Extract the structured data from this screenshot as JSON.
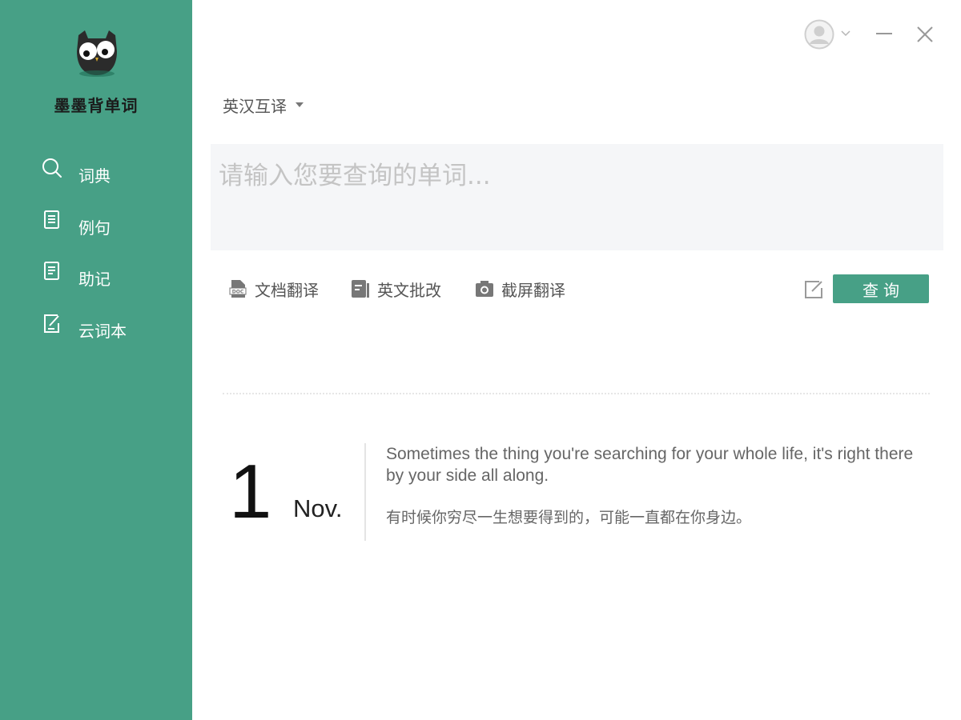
{
  "app": {
    "name": "墨墨背单词",
    "colors": {
      "accent": "#47a086",
      "sidebar_bg": "#47a086",
      "input_bg": "#f5f6f8"
    }
  },
  "sidebar": {
    "logo": "owl-logo-icon",
    "items": [
      {
        "label": "词典",
        "icon": "search-icon"
      },
      {
        "label": "例句",
        "icon": "book-icon"
      },
      {
        "label": "助记",
        "icon": "notebook-icon"
      },
      {
        "label": "云词本",
        "icon": "edit-note-icon"
      }
    ]
  },
  "window_controls": {
    "avatar": "user-avatar-icon",
    "minimize": "minimize-icon",
    "close": "close-icon"
  },
  "main": {
    "language_mode": "英汉互译",
    "search": {
      "placeholder": "请输入您要查询的单词...",
      "value": ""
    },
    "tools": [
      {
        "label": "文档翻译",
        "icon": "doc-file-icon"
      },
      {
        "label": "英文批改",
        "icon": "correction-icon"
      },
      {
        "label": "截屏翻译",
        "icon": "camera-icon"
      }
    ],
    "edit_icon": "edit-icon",
    "query_button": "查询"
  },
  "daily": {
    "day": "1",
    "month": "Nov.",
    "quote_en": "Sometimes the thing you're searching for your whole life, it's right there by your side all along.",
    "quote_zh": "有时候你穷尽一生想要得到的，可能一直都在你身边。"
  }
}
